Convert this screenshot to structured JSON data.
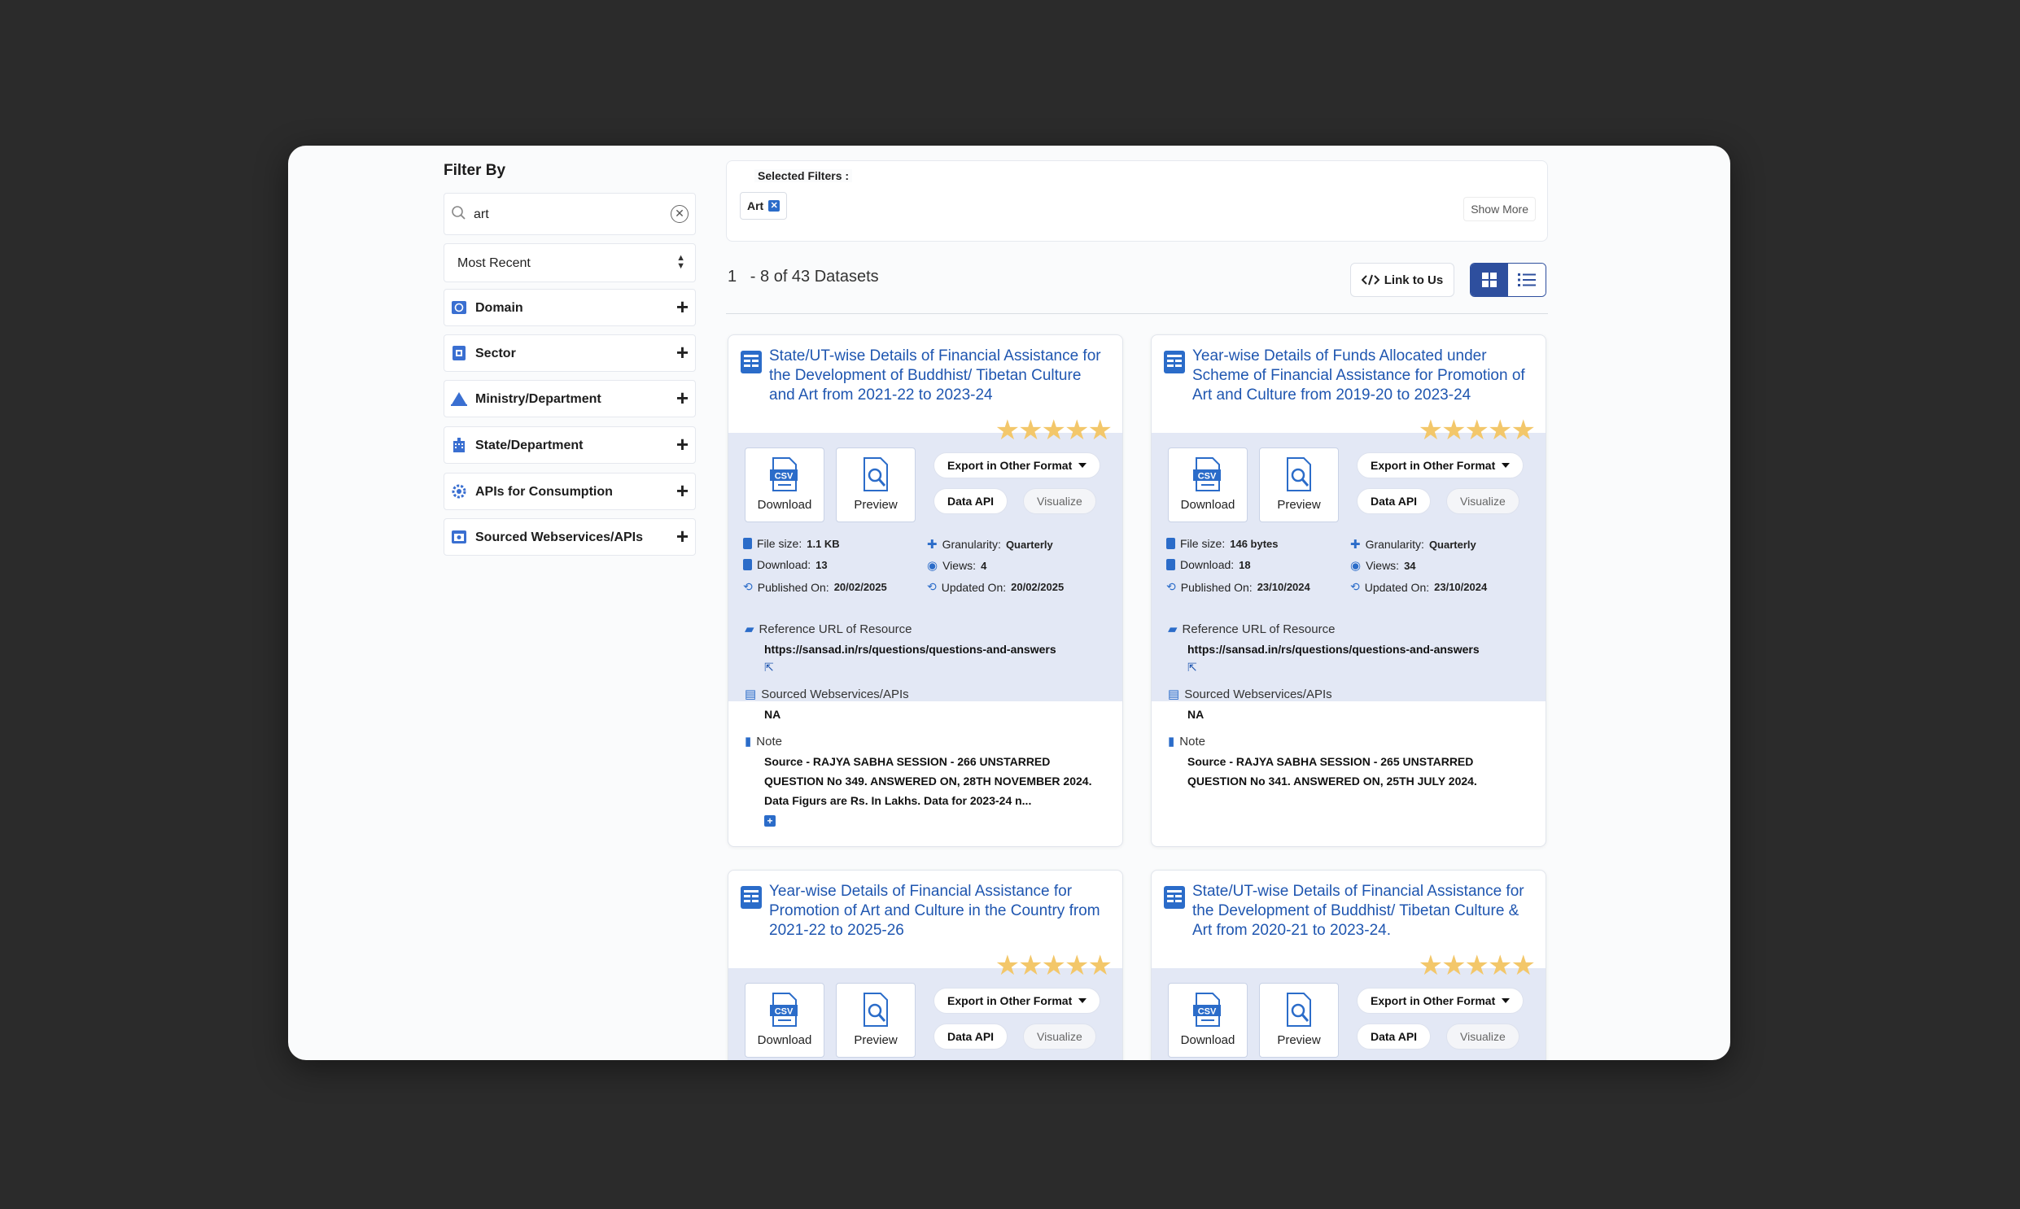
{
  "sidebar": {
    "title": "Filter By",
    "search_value": "art",
    "sort_label": "Most Recent",
    "facets": [
      {
        "label": "Domain",
        "icon": "domain-icon"
      },
      {
        "label": "Sector",
        "icon": "sector-icon"
      },
      {
        "label": "Ministry/Department",
        "icon": "ministry-icon"
      },
      {
        "label": "State/Department",
        "icon": "state-icon"
      },
      {
        "label": "APIs for Consumption",
        "icon": "api-gear-icon"
      },
      {
        "label": "Sourced Webservices/APIs",
        "icon": "webservice-icon"
      }
    ]
  },
  "filters": {
    "title": "Selected Filters :",
    "chips": [
      "Art"
    ],
    "show_more": "Show More"
  },
  "results": {
    "range_start": "1",
    "range_text": "- 8 of 43 Datasets",
    "link_to_us": "Link to Us"
  },
  "labels": {
    "download": "Download",
    "preview": "Preview",
    "export": "Export in Other Format",
    "data_api": "Data API",
    "visualize": "Visualize",
    "file_size": "File size:",
    "download_count": "Download:",
    "published": "Published On:",
    "granularity": "Granularity:",
    "views": "Views:",
    "updated": "Updated On:",
    "ref_url": "Reference URL of Resource",
    "sourced": "Sourced Webservices/APIs",
    "note": "Note",
    "csv": "CSV"
  },
  "cards": [
    {
      "title": "State/UT-wise Details of Financial Assistance for the Development of Buddhist/ Tibetan Culture and Art from 2021-22 to 2023-24",
      "rating": 5,
      "file_size": "1.1 KB",
      "downloads": "13",
      "published": "20/02/2025",
      "granularity": "Quarterly",
      "views": "4",
      "updated": "20/02/2025",
      "ref_url": "https://sansad.in/rs/questions/questions-and-answers",
      "sourced": "NA",
      "note": "Source - RAJYA SABHA SESSION - 266 UNSTARRED QUESTION No 349. ANSWERED ON, 28TH NOVEMBER 2024. Data Figurs are Rs. In Lakhs. Data for 2023-24 n...",
      "note_more": "+"
    },
    {
      "title": "Year-wise Details of Funds Allocated under Scheme of Financial Assistance for Promotion of Art and Culture from 2019-20 to 2023-24",
      "rating": 5,
      "file_size": "146 bytes",
      "downloads": "18",
      "published": "23/10/2024",
      "granularity": "Quarterly",
      "views": "34",
      "updated": "23/10/2024",
      "ref_url": "https://sansad.in/rs/questions/questions-and-answers",
      "sourced": "NA",
      "note": "Source - RAJYA SABHA SESSION - 265 UNSTARRED QUESTION No 341. ANSWERED ON, 25TH JULY 2024."
    },
    {
      "title": "Year-wise Details of Financial Assistance for Promotion of Art and Culture in the Country from 2021-22 to 2025-26",
      "rating": 5
    },
    {
      "title": "State/UT-wise Details of Financial Assistance for the Development of Buddhist/ Tibetan Culture & Art from 2020-21 to 2023-24.",
      "rating": 5
    }
  ],
  "colors": {
    "title_blue": "#1f56b0",
    "accent": "#2e4f9e",
    "star": "#f3c76a",
    "action_bg": "#e3e8f5"
  }
}
